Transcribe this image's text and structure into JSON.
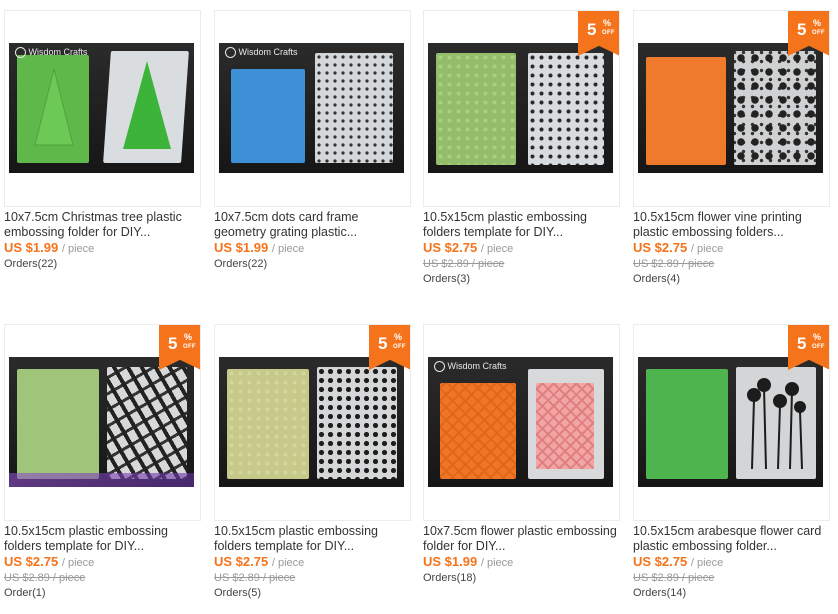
{
  "products": [
    {
      "title": "10x7.5cm Christmas tree plastic embossing folder for DIY...",
      "price_currency": "US $",
      "price": "1.99",
      "price_unit": "/ piece",
      "old_price": "",
      "orders": "Orders(22)",
      "discount": "",
      "logo": "Wisdom Crafts",
      "image_icon": "christmas-tree-embossing-folder-image"
    },
    {
      "title": "10x7.5cm dots card frame geometry grating plastic...",
      "price_currency": "US $",
      "price": "1.99",
      "price_unit": "/ piece",
      "old_price": "",
      "orders": "Orders(22)",
      "discount": "",
      "logo": "Wisdom Crafts",
      "image_icon": "dots-frame-embossing-folder-image"
    },
    {
      "title": "10.5x15cm plastic embossing folders template for DIY...",
      "price_currency": "US $",
      "price": "2.75",
      "price_unit": "/ piece",
      "old_price": "US $2.89 / piece",
      "orders": "Orders(3)",
      "discount": "5",
      "logo": "",
      "image_icon": "dots-embossing-folder-image"
    },
    {
      "title": "10.5x15cm flower vine printing plastic embossing folders...",
      "price_currency": "US $",
      "price": "2.75",
      "price_unit": "/ piece",
      "old_price": "US $2.89 / piece",
      "orders": "Orders(4)",
      "discount": "5",
      "logo": "",
      "image_icon": "flower-vine-embossing-folder-image"
    },
    {
      "title": "10.5x15cm plastic embossing folders template for DIY...",
      "price_currency": "US $",
      "price": "2.75",
      "price_unit": "/ piece",
      "old_price": "US $2.89 / piece",
      "orders": "Order(1)",
      "discount": "5",
      "logo": "",
      "image_icon": "bottles-embossing-folder-image"
    },
    {
      "title": "10.5x15cm plastic embossing folders template for DIY...",
      "price_currency": "US $",
      "price": "2.75",
      "price_unit": "/ piece",
      "old_price": "US $2.89 / piece",
      "orders": "Orders(5)",
      "discount": "5",
      "logo": "",
      "image_icon": "hearts-embossing-folder-image"
    },
    {
      "title": "10x7.5cm flower plastic embossing folder for DIY...",
      "price_currency": "US $",
      "price": "1.99",
      "price_unit": "/ piece",
      "old_price": "",
      "orders": "Orders(18)",
      "discount": "",
      "logo": "Wisdom Crafts",
      "image_icon": "flower-lattice-embossing-folder-image"
    },
    {
      "title": "10.5x15cm arabesque flower card plastic embossing folder...",
      "price_currency": "US $",
      "price": "2.75",
      "price_unit": "/ piece",
      "old_price": "US $2.89 / piece",
      "orders": "Orders(14)",
      "discount": "5",
      "logo": "",
      "image_icon": "arabesque-flower-embossing-folder-image"
    }
  ],
  "badge": {
    "symbol": "%",
    "off": "OFF"
  },
  "colors": {
    "accent": "#f5731b",
    "muted": "#999999",
    "text": "#333333",
    "border": "#ececec",
    "photo_bg": "#1e1e1e"
  }
}
